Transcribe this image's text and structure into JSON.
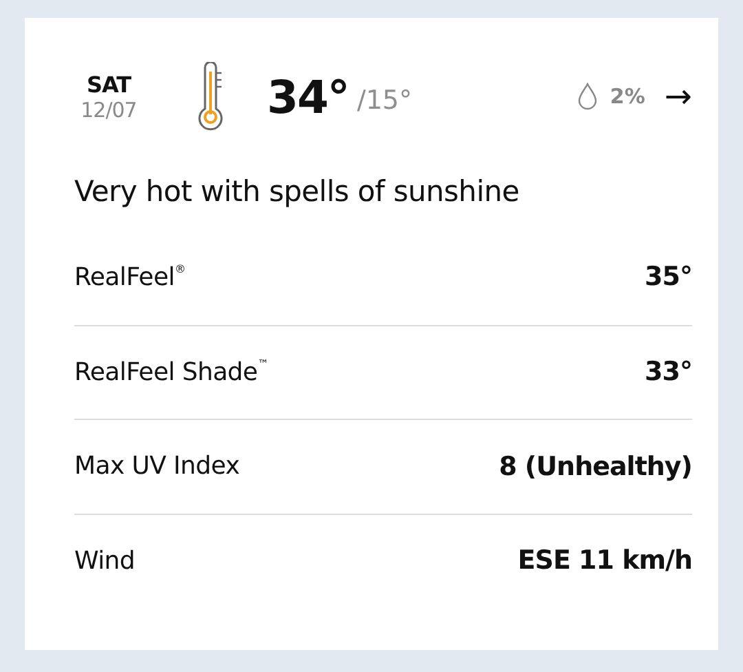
{
  "day": {
    "name": "SAT",
    "date": "12/07"
  },
  "temperature": {
    "high": "34°",
    "low": "/15°"
  },
  "precipitation": "2%",
  "arrow": "→",
  "description": "Very hot with spells of sunshine",
  "details": [
    {
      "label": "RealFeel$^{®}$",
      "value": "35°"
    },
    {
      "label": "RealFeel Shade$^{™}$",
      "value": "33°"
    },
    {
      "label": "Max UV Index",
      "value": "8 (Unhealthy)"
    },
    {
      "label": "Wind",
      "value": "ESE 11 km/h"
    }
  ]
}
